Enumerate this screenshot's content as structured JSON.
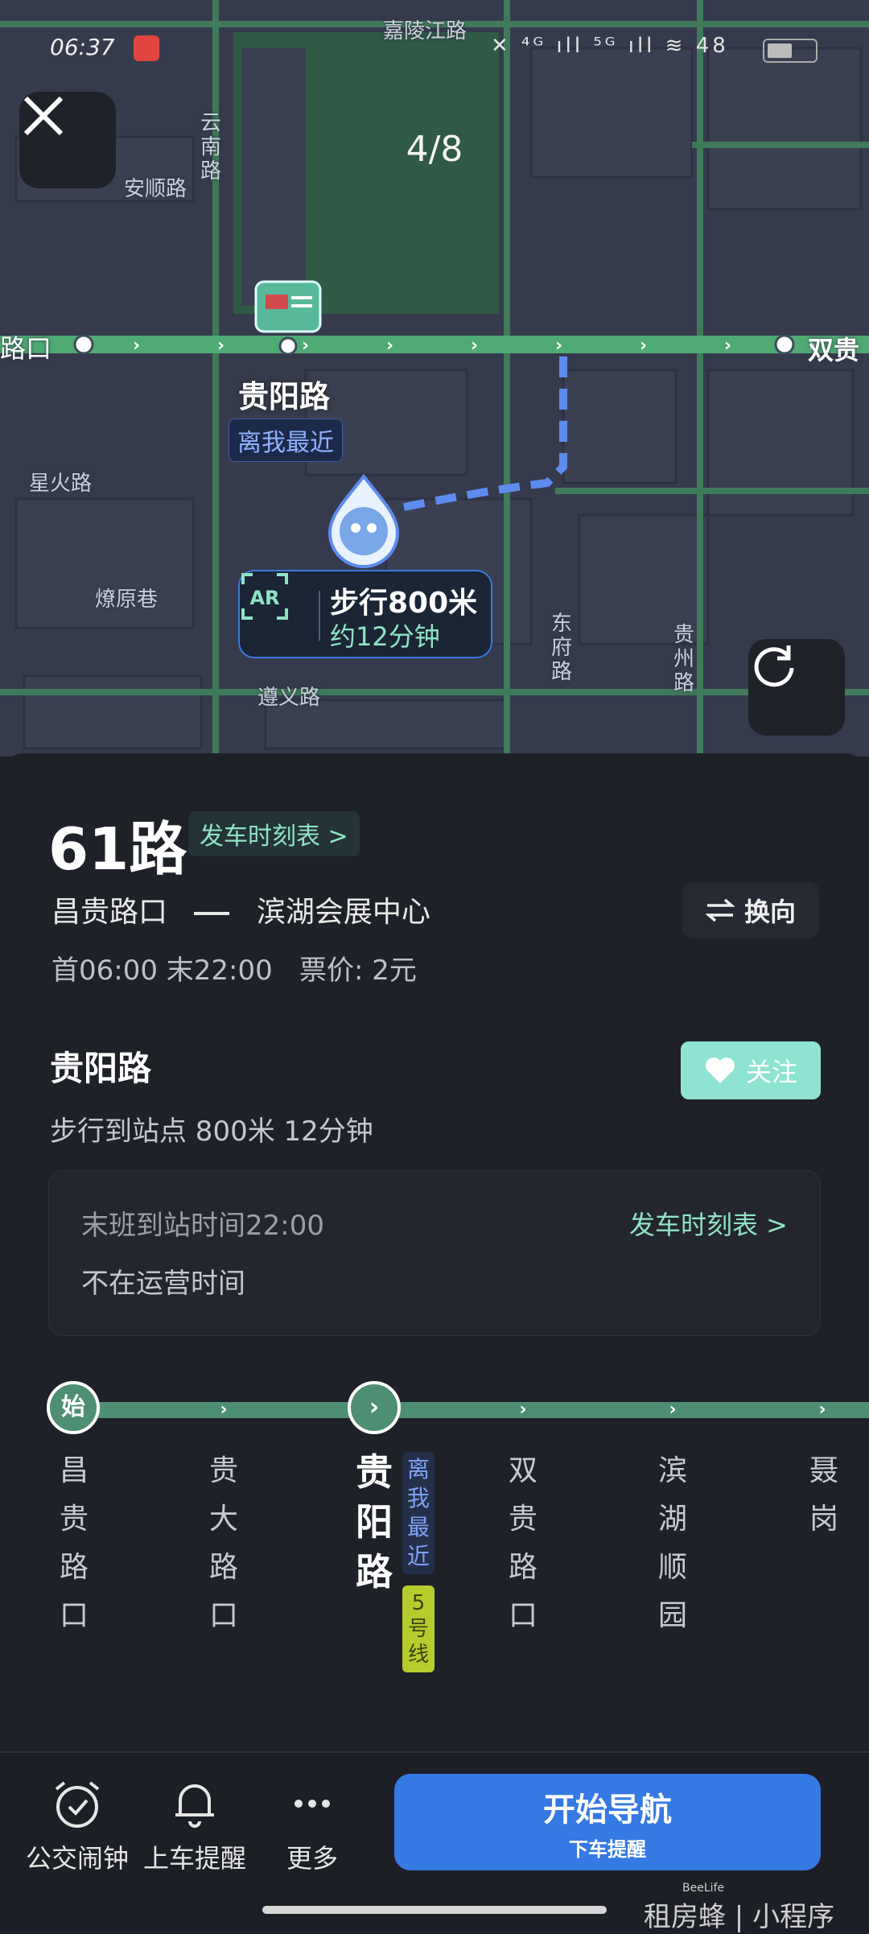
{
  "status_bar": {
    "time": "06:37",
    "right_text": "✕ ⁴ᴳ ıll ⁵ᴳ ıll ≋ 48"
  },
  "map": {
    "counter": "4/8",
    "labels": {
      "jialing": "嘉陵江路",
      "yunnan": "云南路",
      "anshun": "安顺路",
      "luokou": "路口",
      "shuanggui": "双贵",
      "xinghuo": "星火路",
      "liaoyuan": "燎原巷",
      "zunyi": "遵义路",
      "dongfu": "东府路",
      "guizhou": "贵州路"
    },
    "stop_name": "贵阳路",
    "nearest": "离我最近",
    "walk_distance": "步行800米",
    "walk_time": "约12分钟"
  },
  "route": {
    "name": "61路",
    "timetable": "发车时刻表 >",
    "from": "昌贵路口",
    "to": "滨湖会展中心",
    "switch": "换向",
    "service_times": "首06:00 末22:00",
    "fare": "票价: 2元"
  },
  "stop": {
    "name": "贵阳路",
    "follow": "关注",
    "walk_info": "步行到站点 800米 12分钟",
    "last_bus": "末班到站时间22:00",
    "timetable": "发车时刻表 >",
    "status": "不在运营时间"
  },
  "line": {
    "start_badge": "始",
    "current_badge": "›",
    "stops": [
      "昌贵路口",
      "贵大路口",
      "贵阳路",
      "双贵路口",
      "滨湖顺园",
      "聂岗"
    ],
    "nearest_tag": "离我最近",
    "transfer": "5号线"
  },
  "bottom": {
    "alarm": "公交闹钟",
    "remind": "上车提醒",
    "more": "更多",
    "nav_title": "开始导航",
    "nav_sub": "下车提醒"
  },
  "watermark": {
    "brand": "租房蜂 | 小程序",
    "small": "BeeLife"
  },
  "colors": {
    "line_green": "#4e8f74",
    "accent_blue": "#3579e3",
    "mint": "#8fe3c5"
  }
}
